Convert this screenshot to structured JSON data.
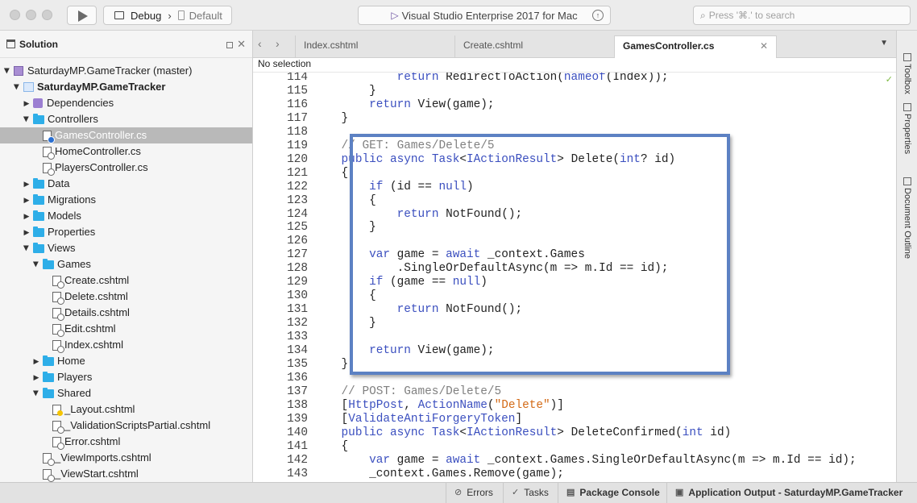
{
  "window": {
    "title": "Visual Studio Enterprise 2017 for Mac",
    "run_icon": "play-icon",
    "configuration": "Debug",
    "separator": "›",
    "device": "Default",
    "search_placeholder": "Press '⌘.' to search"
  },
  "solution_pad": {
    "title": "Solution",
    "close": "✕",
    "items": [
      {
        "label": "SaturdayMP.GameTracker (master)",
        "indent": 0,
        "kind": "solution",
        "expanded": true
      },
      {
        "label": "SaturdayMP.GameTracker",
        "indent": 1,
        "kind": "project",
        "expanded": true,
        "bold": true
      },
      {
        "label": "Dependencies",
        "indent": 2,
        "kind": "deps",
        "expanded": false
      },
      {
        "label": "Controllers",
        "indent": 2,
        "kind": "folder",
        "expanded": true
      },
      {
        "label": "GamesController.cs",
        "indent": 3,
        "kind": "cs",
        "selected": true
      },
      {
        "label": "HomeController.cs",
        "indent": 3,
        "kind": "cs2"
      },
      {
        "label": "PlayersController.cs",
        "indent": 3,
        "kind": "cs2"
      },
      {
        "label": "Data",
        "indent": 2,
        "kind": "folder",
        "expanded": false
      },
      {
        "label": "Migrations",
        "indent": 2,
        "kind": "folder",
        "expanded": false
      },
      {
        "label": "Models",
        "indent": 2,
        "kind": "folder",
        "expanded": false
      },
      {
        "label": "Properties",
        "indent": 2,
        "kind": "folder",
        "expanded": false
      },
      {
        "label": "Views",
        "indent": 2,
        "kind": "folder",
        "expanded": true
      },
      {
        "label": "Games",
        "indent": 3,
        "kind": "folder",
        "expanded": true
      },
      {
        "label": "Create.cshtml",
        "indent": 4,
        "kind": "html"
      },
      {
        "label": "Delete.cshtml",
        "indent": 4,
        "kind": "html"
      },
      {
        "label": "Details.cshtml",
        "indent": 4,
        "kind": "html"
      },
      {
        "label": "Edit.cshtml",
        "indent": 4,
        "kind": "html"
      },
      {
        "label": "Index.cshtml",
        "indent": 4,
        "kind": "html"
      },
      {
        "label": "Home",
        "indent": 3,
        "kind": "folder",
        "expanded": false
      },
      {
        "label": "Players",
        "indent": 3,
        "kind": "folder",
        "expanded": false
      },
      {
        "label": "Shared",
        "indent": 3,
        "kind": "folder",
        "expanded": true
      },
      {
        "label": "_Layout.cshtml",
        "indent": 4,
        "kind": "yel"
      },
      {
        "label": "_ValidationScriptsPartial.cshtml",
        "indent": 4,
        "kind": "html"
      },
      {
        "label": "Error.cshtml",
        "indent": 4,
        "kind": "html"
      },
      {
        "label": "_ViewImports.cshtml",
        "indent": 3,
        "kind": "html"
      },
      {
        "label": "_ViewStart.cshtml",
        "indent": 3,
        "kind": "html"
      }
    ]
  },
  "tabs": [
    {
      "label": "Index.cshtml",
      "active": false
    },
    {
      "label": "Create.cshtml",
      "active": false
    },
    {
      "label": "GamesController.cs",
      "active": true
    }
  ],
  "tab_close": "✕",
  "breadcrumb": "No selection",
  "code_lines": [
    {
      "n": "114",
      "tokens": [
        [
          "",
          "            "
        ],
        [
          "kw",
          "return"
        ],
        [
          "",
          " RedirectToAction("
        ],
        [
          "kw",
          "nameof"
        ],
        [
          "",
          "(Index));"
        ]
      ]
    },
    {
      "n": "115",
      "tokens": [
        [
          "",
          "        }"
        ]
      ]
    },
    {
      "n": "116",
      "tokens": [
        [
          "",
          "        "
        ],
        [
          "kw",
          "return"
        ],
        [
          "",
          " View(game);"
        ]
      ]
    },
    {
      "n": "117",
      "tokens": [
        [
          "",
          "    }"
        ]
      ]
    },
    {
      "n": "118",
      "tokens": []
    },
    {
      "n": "119",
      "tokens": [
        [
          "cm",
          "    // GET: Games/Delete/5"
        ]
      ]
    },
    {
      "n": "120",
      "tokens": [
        [
          "",
          "    "
        ],
        [
          "kw",
          "public"
        ],
        [
          "",
          " "
        ],
        [
          "kw",
          "async"
        ],
        [
          "",
          " "
        ],
        [
          "ty",
          "Task"
        ],
        [
          "",
          "<"
        ],
        [
          "ty",
          "IActionResult"
        ],
        [
          "",
          "> Delete("
        ],
        [
          "kw",
          "int"
        ],
        [
          "",
          "? id)"
        ]
      ]
    },
    {
      "n": "121",
      "tokens": [
        [
          "",
          "    {"
        ]
      ]
    },
    {
      "n": "122",
      "tokens": [
        [
          "",
          "        "
        ],
        [
          "kw",
          "if"
        ],
        [
          "",
          " (id == "
        ],
        [
          "kw",
          "null"
        ],
        [
          "",
          ")"
        ]
      ]
    },
    {
      "n": "123",
      "tokens": [
        [
          "",
          "        {"
        ]
      ]
    },
    {
      "n": "124",
      "tokens": [
        [
          "",
          "            "
        ],
        [
          "kw",
          "return"
        ],
        [
          "",
          " NotFound();"
        ]
      ]
    },
    {
      "n": "125",
      "tokens": [
        [
          "",
          "        }"
        ]
      ]
    },
    {
      "n": "126",
      "tokens": []
    },
    {
      "n": "127",
      "tokens": [
        [
          "",
          "        "
        ],
        [
          "kw",
          "var"
        ],
        [
          "",
          " game = "
        ],
        [
          "kw",
          "await"
        ],
        [
          "",
          " _context.Games"
        ]
      ]
    },
    {
      "n": "128",
      "tokens": [
        [
          "",
          "            .SingleOrDefaultAsync(m => m.Id == id);"
        ]
      ]
    },
    {
      "n": "129",
      "tokens": [
        [
          "",
          "        "
        ],
        [
          "kw",
          "if"
        ],
        [
          "",
          " (game == "
        ],
        [
          "kw",
          "null"
        ],
        [
          "",
          ")"
        ]
      ]
    },
    {
      "n": "130",
      "tokens": [
        [
          "",
          "        {"
        ]
      ]
    },
    {
      "n": "131",
      "tokens": [
        [
          "",
          "            "
        ],
        [
          "kw",
          "return"
        ],
        [
          "",
          " NotFound();"
        ]
      ]
    },
    {
      "n": "132",
      "tokens": [
        [
          "",
          "        }"
        ]
      ]
    },
    {
      "n": "133",
      "tokens": []
    },
    {
      "n": "134",
      "tokens": [
        [
          "",
          "        "
        ],
        [
          "kw",
          "return"
        ],
        [
          "",
          " View(game);"
        ]
      ]
    },
    {
      "n": "135",
      "tokens": [
        [
          "",
          "    }"
        ]
      ]
    },
    {
      "n": "136",
      "tokens": []
    },
    {
      "n": "137",
      "tokens": [
        [
          "cm",
          "    // POST: Games/Delete/5"
        ]
      ]
    },
    {
      "n": "138",
      "tokens": [
        [
          "",
          "    ["
        ],
        [
          "ty",
          "HttpPost"
        ],
        [
          "",
          ", "
        ],
        [
          "ty",
          "ActionName"
        ],
        [
          "",
          "("
        ],
        [
          "st",
          "\"Delete\""
        ],
        [
          "",
          ")]"
        ]
      ]
    },
    {
      "n": "139",
      "tokens": [
        [
          "",
          "    ["
        ],
        [
          "ty",
          "ValidateAntiForgeryToken"
        ],
        [
          "",
          "]"
        ]
      ]
    },
    {
      "n": "140",
      "tokens": [
        [
          "",
          "    "
        ],
        [
          "kw",
          "public"
        ],
        [
          "",
          " "
        ],
        [
          "kw",
          "async"
        ],
        [
          "",
          " "
        ],
        [
          "ty",
          "Task"
        ],
        [
          "",
          "<"
        ],
        [
          "ty",
          "IActionResult"
        ],
        [
          "",
          "> DeleteConfirmed("
        ],
        [
          "kw",
          "int"
        ],
        [
          "",
          " id)"
        ]
      ]
    },
    {
      "n": "141",
      "tokens": [
        [
          "",
          "    {"
        ]
      ]
    },
    {
      "n": "142",
      "tokens": [
        [
          "",
          "        "
        ],
        [
          "kw",
          "var"
        ],
        [
          "",
          " game = "
        ],
        [
          "kw",
          "await"
        ],
        [
          "",
          " _context.Games.SingleOrDefaultAsync(m => m.Id == id);"
        ]
      ]
    },
    {
      "n": "143",
      "tokens": [
        [
          "",
          "        _context.Games.Remove(game);"
        ]
      ]
    }
  ],
  "right_pads": [
    "Toolbox",
    "Properties",
    "Document Outline"
  ],
  "status_pads": [
    {
      "label": "Errors",
      "icon": "errors-icon",
      "glyph": "⊘"
    },
    {
      "label": "Tasks",
      "icon": "tasks-icon",
      "glyph": "✓"
    },
    {
      "label": "Package Console",
      "icon": "console-icon",
      "glyph": "▤"
    },
    {
      "label": "Application Output - SaturdayMP.GameTracker",
      "icon": "output-icon",
      "glyph": "▣"
    }
  ],
  "colors": {
    "keyword": "#3b4fbf",
    "comment": "#808080",
    "string": "#d36a16",
    "highlight_border": "#5c81c3",
    "selection": "#b9b9b9"
  }
}
